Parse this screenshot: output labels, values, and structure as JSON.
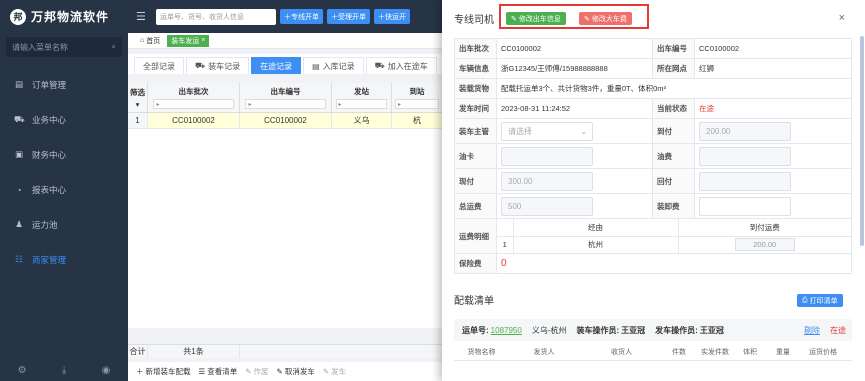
{
  "app": {
    "logo_char": "邦",
    "title": "万邦物流软件"
  },
  "sidebar": {
    "search_placeholder": "请输入菜单名称",
    "items": [
      {
        "label": "订单管理",
        "icon": "document-icon"
      },
      {
        "label": "业务中心",
        "icon": "truck-icon"
      },
      {
        "label": "财务中心",
        "icon": "wallet-icon"
      },
      {
        "label": "报表中心",
        "icon": "chart-icon"
      },
      {
        "label": "运力池",
        "icon": "user-icon"
      },
      {
        "label": "商家管理",
        "icon": "group-icon"
      }
    ],
    "active_index": 5
  },
  "topbar": {
    "search_placeholder": "运单号、货号、收货人信息",
    "buttons": [
      "专线开单",
      "受理开单",
      "快运开"
    ]
  },
  "page_tabs": [
    {
      "label": "首页"
    },
    {
      "label": "装车发运",
      "close": "×"
    }
  ],
  "record_tabs": [
    {
      "label": "全部记录"
    },
    {
      "label": "装车记录"
    },
    {
      "label": "在途记录"
    },
    {
      "label": "入库记录"
    },
    {
      "label": "加入在途车"
    }
  ],
  "grid": {
    "columns": [
      "筛选",
      "出车批次",
      "出车编号",
      "发站",
      "到站"
    ],
    "filter_glyph": "▸",
    "rows": [
      {
        "no": "1",
        "batch": "CC0100002",
        "code": "CC0100002",
        "from": "义乌",
        "to": "杭"
      }
    ],
    "footer": {
      "label": "合计",
      "count": "共1条"
    }
  },
  "actions": [
    "新增装车配载",
    "查看清单",
    "作废",
    "取消发车",
    "发车"
  ],
  "panel": {
    "title": "专线司机",
    "btn_edit_info": "修改出车信息",
    "btn_edit_fee": "修改大车费",
    "close": "×",
    "info": {
      "batch_label": "出车批次",
      "batch_value": "CC0100002",
      "code_label": "出车编号",
      "code_value": "CC0100002",
      "vehicle_label": "车辆信息",
      "vehicle_value": "浙G12345/王师傅/15988888888",
      "site_label": "所在网点",
      "site_value": "红狮",
      "goods_label": "装载货物",
      "goods_value": "配载托运单3个、共计货物3件，重量0T、体积0m³",
      "time_label": "发车时间",
      "time_value": "2023-08-31 11:24:52",
      "status_label": "当前状态",
      "status_value": "在途",
      "owner_label": "装车主管",
      "owner_placeholder": "请选择",
      "arrive_label": "到付",
      "arrive_value": "200.00",
      "fuel_label": "油卡",
      "oilfee_label": "油费",
      "cash_label": "现付",
      "cash_value": "300.00",
      "return_label": "回付",
      "total_label": "总运费",
      "total_value": "500",
      "unload_label": "装卸费",
      "detail_label": "运费明细",
      "detail_head_via": "经由",
      "detail_head_arrive": "到付运费",
      "detail_row_no": "1",
      "detail_row_city": "杭州",
      "detail_row_amount": "200.00",
      "insure_label": "保险费",
      "insure_value": "0"
    },
    "manifest": {
      "title": "配载清单",
      "print": "打印清单",
      "waybill_label": "运单号:",
      "waybill_no": "1087950",
      "route": "义乌-杭州",
      "loader_label": "装车操作员:",
      "loader": "王亚冠",
      "sender_label": "发车操作员:",
      "sender": "王亚冠",
      "remove": "剔除",
      "status": "在途",
      "columns": [
        "货物名称",
        "发货人",
        "收货人",
        "件数",
        "实发件数",
        "体积",
        "重量",
        "运货价格"
      ]
    }
  },
  "colors": {
    "primary": "#3d8ff3",
    "green": "#4caf50",
    "red": "#e53935",
    "sidebar": "#263445"
  }
}
